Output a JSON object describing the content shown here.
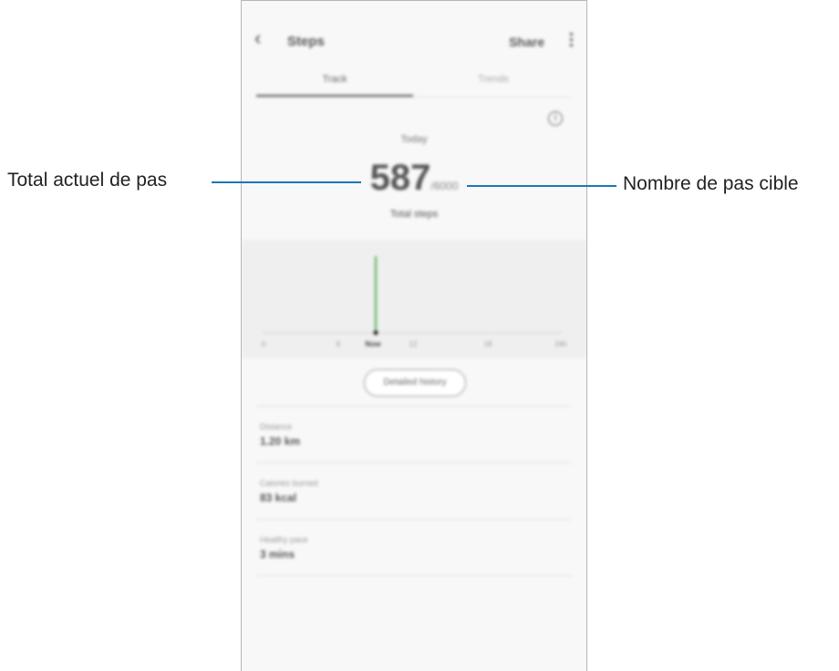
{
  "header": {
    "back_icon": "back-arrow-icon",
    "title": "Steps",
    "right_label": "Share",
    "more_icon": "more-vertical-icon"
  },
  "tabs": [
    {
      "label": "Track",
      "active": true
    },
    {
      "label": "Trends",
      "active": false
    }
  ],
  "summary": {
    "info_icon": "info-icon",
    "today_label": "Today",
    "steps_count": "587",
    "target": "/6000",
    "steps_unit": "Total steps"
  },
  "chart_data": {
    "type": "bar",
    "x_ticks": [
      "0",
      "6",
      "Now",
      "12",
      "18",
      "24h"
    ],
    "highlight_tick": "Now",
    "bar_color": "#4caf50"
  },
  "action_button": "Detailed history",
  "stats": [
    {
      "label": "Distance",
      "value": "1.20 km"
    },
    {
      "label": "Calories burned",
      "value": "83 kcal"
    },
    {
      "label": "Healthy pace",
      "value": "3 mins"
    }
  ],
  "callouts": {
    "left": "Total actuel de pas",
    "right": "Nombre de pas cible"
  },
  "colors": {
    "callout_line": "#1a78b4",
    "chart_bg": "#efefef"
  }
}
